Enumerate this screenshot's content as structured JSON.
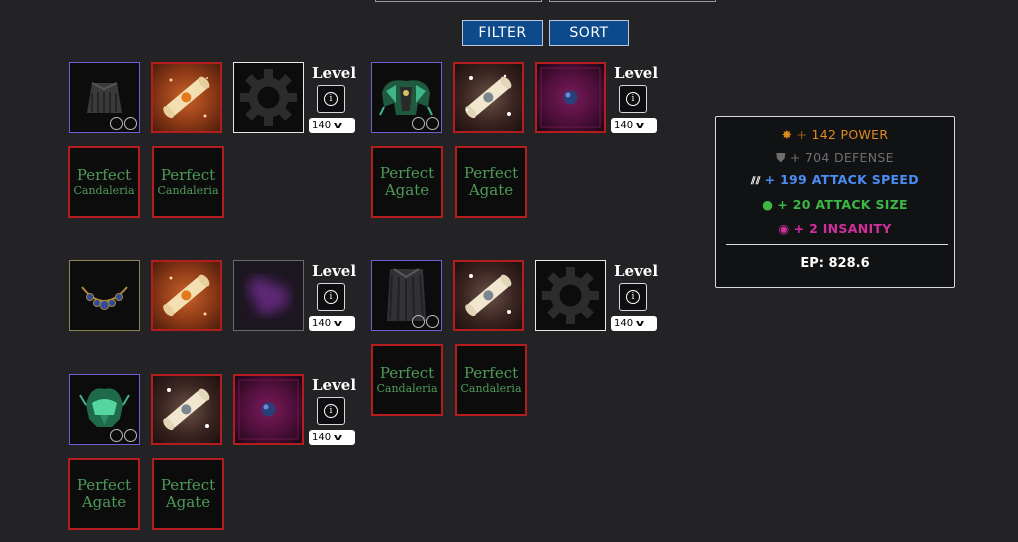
{
  "header": {
    "filter_label": "FILTER",
    "sort_label": "SORT"
  },
  "builds": [
    {
      "level_label": "Level",
      "level_value": "140",
      "slots": [
        "cape-icon",
        "scroll-orange-icon",
        "gear-icon"
      ],
      "gems": [
        {
          "line1": "Perfect",
          "line2": "Candaleria"
        },
        {
          "line1": "Perfect",
          "line2": "Candaleria"
        }
      ]
    },
    {
      "level_label": "Level",
      "level_value": "140",
      "slots": [
        "pauldrons-icon",
        "scroll-white-icon",
        "purple-orb-icon"
      ],
      "gems": [
        {
          "line1": "Perfect",
          "line2": "Agate"
        },
        {
          "line1": "Perfect",
          "line2": "Agate"
        }
      ]
    },
    {
      "level_label": "Level",
      "level_value": "140",
      "slots": [
        "necklace-icon",
        "scroll-orange-icon",
        "purple-blur-icon"
      ],
      "gems": []
    },
    {
      "level_label": "Level",
      "level_value": "140",
      "slots": [
        "robe-icon",
        "scroll-white-icon",
        "gear-icon"
      ],
      "gems": [
        {
          "line1": "Perfect",
          "line2": "Candaleria"
        },
        {
          "line1": "Perfect",
          "line2": "Candaleria"
        }
      ]
    },
    {
      "level_label": "Level",
      "level_value": "140",
      "slots": [
        "helmet-icon",
        "scroll-white-icon",
        "purple-orb-icon"
      ],
      "gems": [
        {
          "line1": "Perfect",
          "line2": "Agate"
        },
        {
          "line1": "Perfect",
          "line2": "Agate"
        }
      ]
    }
  ],
  "stats": {
    "power": {
      "prefix": "+",
      "text": "142 POWER",
      "icon": "power-star-icon",
      "color": "#e08a1e"
    },
    "defense": {
      "prefix": "+",
      "text": "704 DEFENSE",
      "icon": "shield-icon",
      "color": "#6e6e6e"
    },
    "attack_speed": {
      "prefix": "+",
      "text": "199 ATTACK SPEED",
      "icon": "speed-icon",
      "color": "#4c8cf5"
    },
    "attack_size": {
      "prefix": "+",
      "text": "20 ATTACK SIZE",
      "icon": "size-orb-icon",
      "color": "#3cb843"
    },
    "insanity": {
      "prefix": "+",
      "text": "2 INSANITY",
      "icon": "eye-icon",
      "color": "#d12f9b"
    },
    "ep": "EP: 828.6"
  }
}
